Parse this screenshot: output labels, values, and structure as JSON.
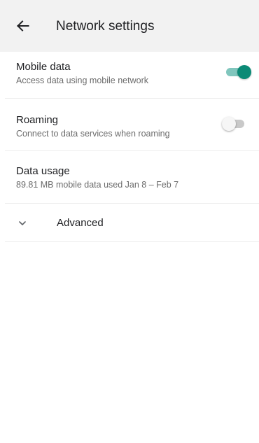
{
  "app_bar": {
    "title": "Network settings",
    "back_icon": "arrow-back-icon"
  },
  "settings": {
    "mobile_data": {
      "title": "Mobile data",
      "subtitle": "Access data using mobile network",
      "enabled": true
    },
    "roaming": {
      "title": "Roaming",
      "subtitle": "Connect to data services when roaming",
      "enabled": false
    },
    "data_usage": {
      "title": "Data usage",
      "subtitle": "89.81 MB mobile data used Jan 8 – Feb 7"
    },
    "advanced": {
      "label": "Advanced",
      "icon": "chevron-down-icon"
    }
  },
  "colors": {
    "toggle_on_thumb": "#0b8a76",
    "toggle_on_track": "#80c6bd",
    "toggle_off_thumb": "#f6f6f6",
    "toggle_off_track": "#c9c9c9",
    "app_bar_bg": "#f2f2f2"
  }
}
